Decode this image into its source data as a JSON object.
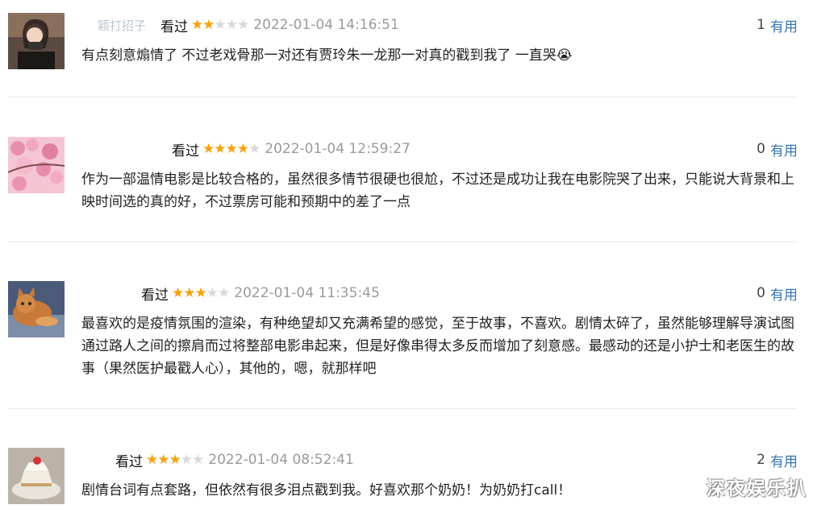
{
  "comments": [
    {
      "username": "颖打招子",
      "watched_label": "看过",
      "rating": 2,
      "time": "2022-01-04 14:16:51",
      "votes": "1",
      "useful_label": "有用",
      "content": "有点刻意煽情了 不过老戏骨那一对还有贾玲朱一龙那一对真的戳到我了 一直哭😭"
    },
    {
      "username": "",
      "watched_label": "看过",
      "rating": 4,
      "time": "2022-01-04 12:59:27",
      "votes": "0",
      "useful_label": "有用",
      "content": "作为一部温情电影是比较合格的，虽然很多情节很硬也很尬，不过还是成功让我在电影院哭了出来，只能说大背景和上映时间选的真的好，不过票房可能和预期中的差了一点"
    },
    {
      "username": "",
      "watched_label": "看过",
      "rating": 3,
      "time": "2022-01-04 11:35:45",
      "votes": "0",
      "useful_label": "有用",
      "content": "最喜欢的是疫情氛围的渲染，有种绝望却又充满希望的感觉，至于故事，不喜欢。剧情太碎了，虽然能够理解导演试图通过路人之间的擦肩而过将整部电影串起来，但是好像串得太多反而增加了刻意感。最感动的还是小护士和老医生的故事（果然医护最戳人心），其他的，嗯，就那样吧"
    },
    {
      "username": "",
      "watched_label": "看过",
      "rating": 3,
      "time": "2022-01-04 08:52:41",
      "votes": "2",
      "useful_label": "有用",
      "content": "剧情台词有点套路，但依然有很多泪点戳到我。好喜欢那个奶奶！为奶奶打call！"
    }
  ],
  "watermark": "深夜娱乐扒",
  "colors": {
    "star_on": "#f7a10d",
    "star_off": "#d8d8d8",
    "link": "#3477b6",
    "time": "#9a9a9a"
  }
}
